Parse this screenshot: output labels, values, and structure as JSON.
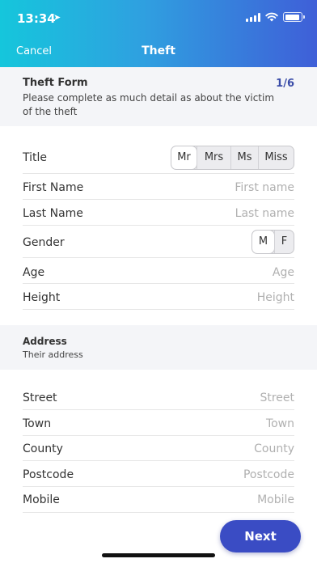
{
  "status_bar": {
    "time": "13:34"
  },
  "nav": {
    "cancel_label": "Cancel",
    "title": "Theft"
  },
  "form_header": {
    "title": "Theft Form",
    "step": "1/6",
    "description": "Please complete as much detail as about the victim of the theft"
  },
  "personal_fields": {
    "title": {
      "label": "Title",
      "options": [
        "Mr",
        "Mrs",
        "Ms",
        "Miss"
      ],
      "selected": "Mr"
    },
    "first_name": {
      "label": "First Name",
      "placeholder": "First name"
    },
    "last_name": {
      "label": "Last Name",
      "placeholder": "Last name"
    },
    "gender": {
      "label": "Gender",
      "options": [
        "M",
        "F"
      ],
      "selected": "M"
    },
    "age": {
      "label": "Age",
      "placeholder": "Age"
    },
    "height": {
      "label": "Height",
      "placeholder": "Height"
    }
  },
  "address_header": {
    "title": "Address",
    "description": "Their address"
  },
  "address_fields": {
    "street": {
      "label": "Street",
      "placeholder": "Street"
    },
    "town": {
      "label": "Town",
      "placeholder": "Town"
    },
    "county": {
      "label": "County",
      "placeholder": "County"
    },
    "postcode": {
      "label": "Postcode",
      "placeholder": "Postcode"
    },
    "mobile": {
      "label": "Mobile",
      "placeholder": "Mobile"
    }
  },
  "next_button": {
    "label": "Next"
  },
  "colors": {
    "accent": "#3a4cc4",
    "gradient_start": "#15c6dc",
    "gradient_end": "#3f5fd8",
    "placeholder": "#b0b0b0"
  }
}
